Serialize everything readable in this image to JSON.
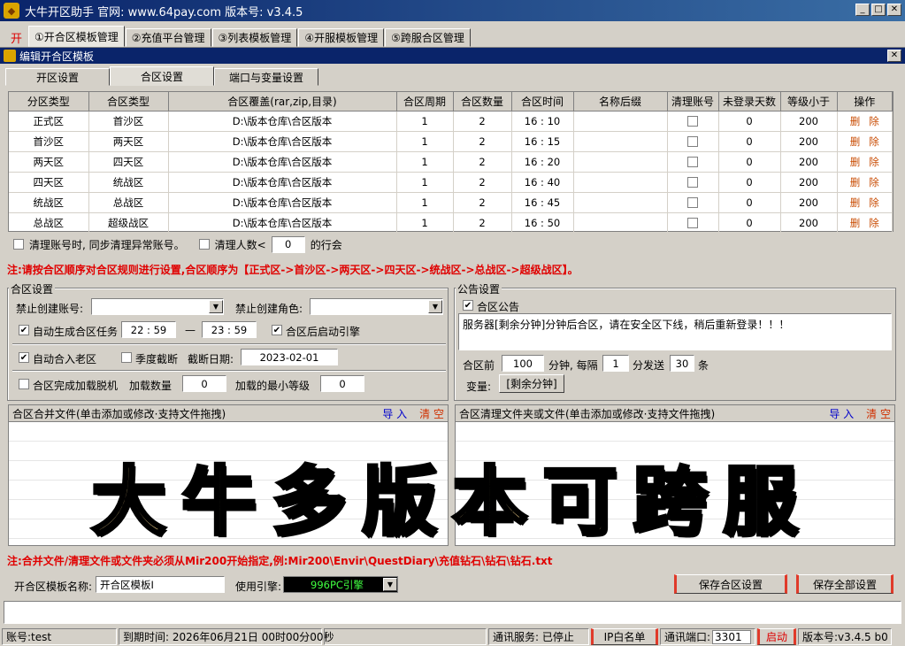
{
  "window": {
    "title": "大牛开区助手 官网: www.64pay.com 版本号: v3.4.5",
    "icon": "bull-icon"
  },
  "main_tabs": {
    "kai": "开",
    "items": [
      "①开合区模板管理",
      "②充值平台管理",
      "③列表模板管理",
      "④开服模板管理",
      "⑤跨服合区管理"
    ]
  },
  "subwindow": {
    "title": "编辑开合区模板"
  },
  "sub_tabs": [
    "开区设置",
    "合区设置",
    "端口与变量设置"
  ],
  "table": {
    "headers": [
      "分区类型",
      "合区类型",
      "合区覆盖(rar,zip,目录)",
      "合区周期",
      "合区数量",
      "合区时间",
      "名称后缀",
      "清理账号",
      "未登录天数",
      "等级小于",
      "操作"
    ],
    "rows": [
      {
        "zone": "正式区",
        "merge": "首沙区",
        "path": "D:\\版本仓库\\合区版本",
        "cycle": "1",
        "count": "2",
        "time": "16 : 10",
        "suffix": "",
        "clear": false,
        "days": "0",
        "level": "200"
      },
      {
        "zone": "首沙区",
        "merge": "两天区",
        "path": "D:\\版本仓库\\合区版本",
        "cycle": "1",
        "count": "2",
        "time": "16 : 15",
        "suffix": "",
        "clear": false,
        "days": "0",
        "level": "200"
      },
      {
        "zone": "两天区",
        "merge": "四天区",
        "path": "D:\\版本仓库\\合区版本",
        "cycle": "1",
        "count": "2",
        "time": "16 : 20",
        "suffix": "",
        "clear": false,
        "days": "0",
        "level": "200"
      },
      {
        "zone": "四天区",
        "merge": "统战区",
        "path": "D:\\版本仓库\\合区版本",
        "cycle": "1",
        "count": "2",
        "time": "16 : 40",
        "suffix": "",
        "clear": false,
        "days": "0",
        "level": "200"
      },
      {
        "zone": "统战区",
        "merge": "总战区",
        "path": "D:\\版本仓库\\合区版本",
        "cycle": "1",
        "count": "2",
        "time": "16 : 45",
        "suffix": "",
        "clear": false,
        "days": "0",
        "level": "200"
      },
      {
        "zone": "总战区",
        "merge": "超级战区",
        "path": "D:\\版本仓库\\合区版本",
        "cycle": "1",
        "count": "2",
        "time": "16 : 50",
        "suffix": "",
        "clear": false,
        "days": "0",
        "level": "200"
      }
    ],
    "op_delete": "删",
    "op_remove": "除"
  },
  "table_footer": {
    "sync_label": "清理账号时, 同步清理异常账号。",
    "count_label": "清理人数<",
    "count_value": "0",
    "count_suffix": "的行会"
  },
  "note1": "注:请按合区顺序对合区规则进行设置,合区顺序为【正式区->首沙区->两天区->四天区->统战区->总战区->超级战区】。",
  "merge_settings": {
    "title": "合区设置",
    "ban_account_label": "禁止创建账号:",
    "ban_account_value": "",
    "ban_role_label": "禁止创建角色:",
    "ban_role_value": "",
    "auto_task_label": "自动生成合区任务",
    "auto_task_checked": true,
    "time_start": "22 : 59",
    "dash": "—",
    "time_end": "23 : 59",
    "start_engine_label": "合区后启动引擎",
    "start_engine_checked": true,
    "auto_old_label": "自动合入老区",
    "auto_old_checked": true,
    "season_label": "季度截断",
    "season_checked": false,
    "cut_date_label": "截断日期:",
    "cut_date_value": "2023-02-01",
    "offline_label": "合区完成加载脱机",
    "offline_checked": false,
    "load_count_label": "加载数量",
    "load_count_value": "0",
    "min_level_label": "加载的最小等级",
    "min_level_value": "0"
  },
  "notice_settings": {
    "title": "公告设置",
    "notice_label": "合区公告",
    "notice_checked": true,
    "notice_text": "服务器[剩余分钟]分钟后合区，请在安全区下线，稍后重新登录！！！",
    "before_label": "合区前",
    "before_value": "100",
    "every_label": "分钟, 每隔",
    "every_value": "1",
    "send_label": "分发送",
    "send_value": "30",
    "send_unit": "条",
    "var_label": "变量:",
    "var_button": "[剩余分钟]"
  },
  "file_merge": {
    "title": "合区合并文件(单击添加或修改·支持文件拖拽)",
    "import": "导 入",
    "clear": "清 空"
  },
  "file_clean": {
    "title": "合区清理文件夹或文件(单击添加或修改·支持文件拖拽)",
    "import": "导 入",
    "clear": "清 空"
  },
  "watermark": "大牛多版本可跨服",
  "note2": "注:合并文件/清理文件或文件夹必须从Mir200开始指定,例:Mir200\\Envir\\QuestDiary\\充值钻石\\钻石\\钻石.txt",
  "bottom": {
    "template_name_label": "开合区模板名称:",
    "template_name_value": "开合区模板I",
    "engine_label": "使用引擎:",
    "engine_value": "996PC引擎",
    "save_merge": "保存合区设置",
    "save_all": "保存全部设置"
  },
  "status": {
    "account": "账号:test",
    "expire": "到期时间: 2026年06月21日 00时00分00秒",
    "comm": "通讯服务: 已停止",
    "whitelist": "IP白名单",
    "port_label": "通讯端口:",
    "port_value": "3301",
    "start": "启动",
    "version": "版本号:v3.4.5 b0"
  },
  "colors": {
    "accent": "#0a246a",
    "warning": "#e00000",
    "operation": "#c84a00"
  }
}
